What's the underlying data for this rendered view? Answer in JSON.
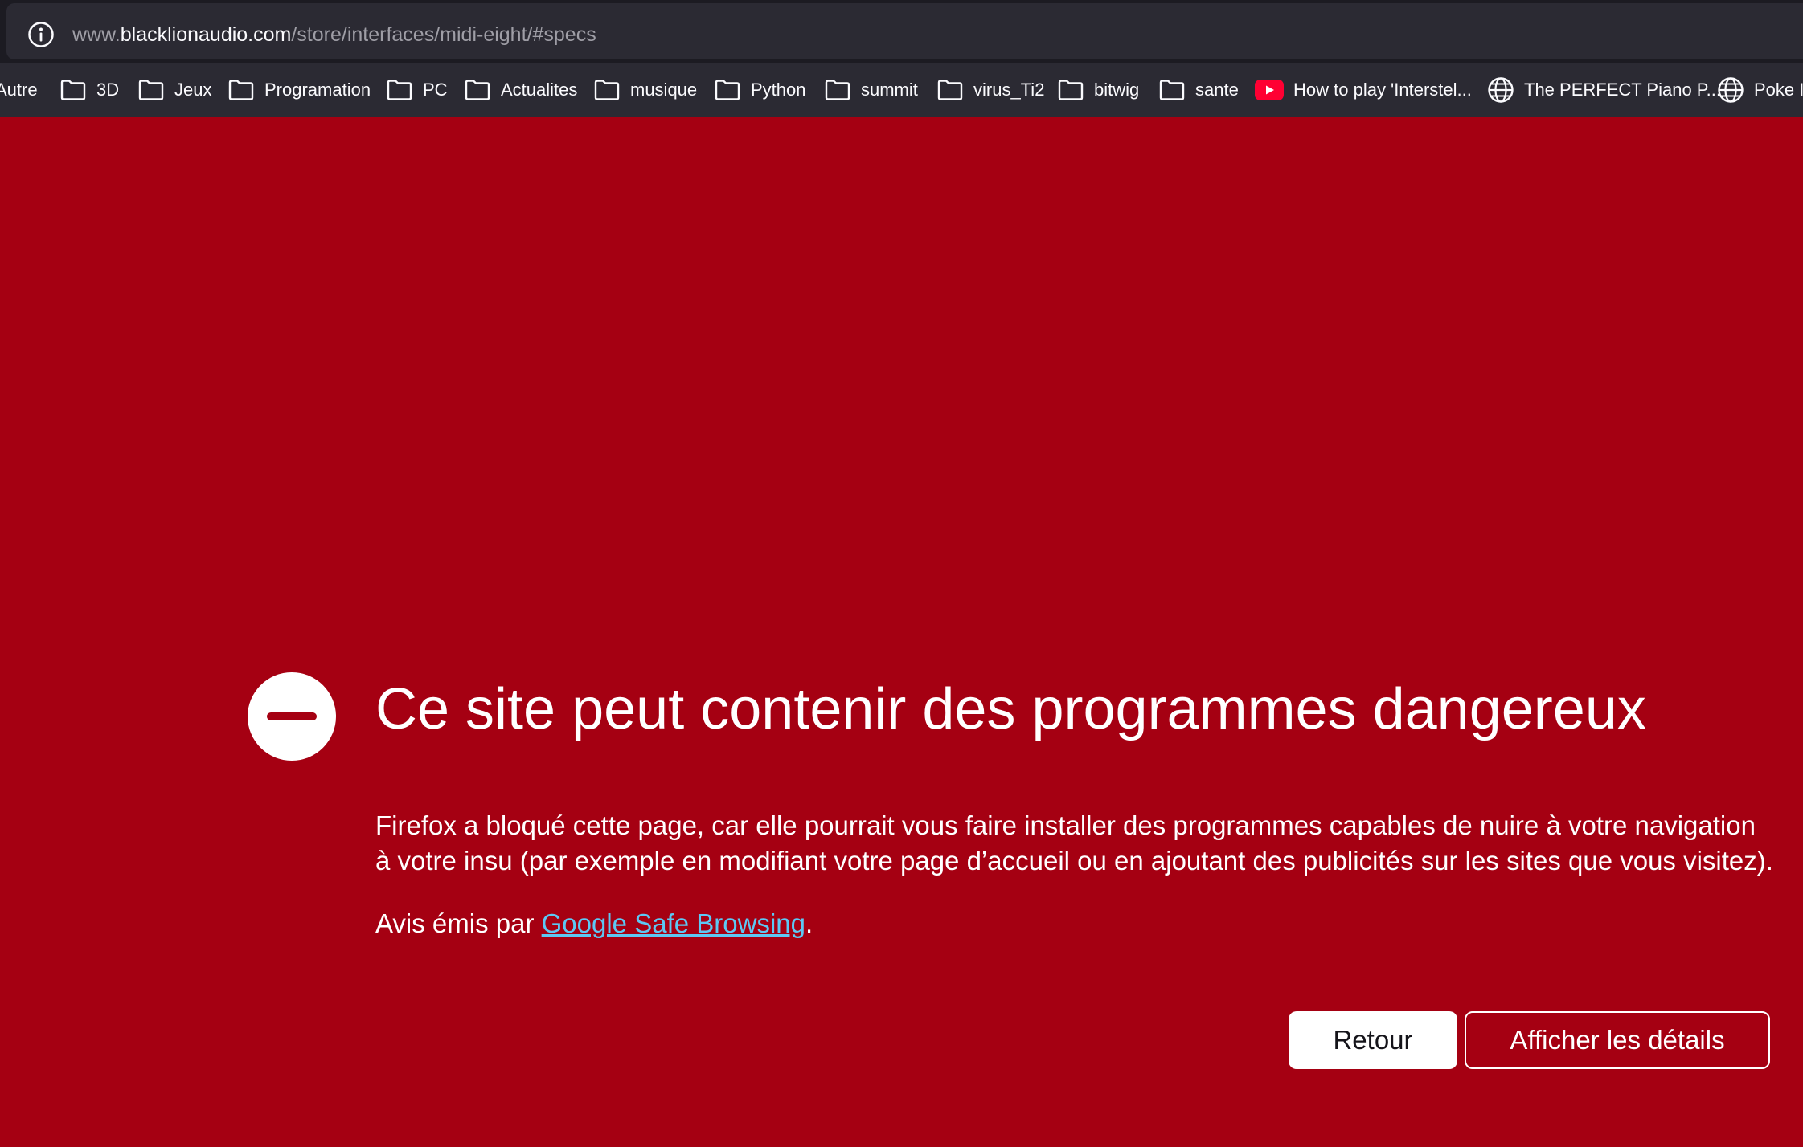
{
  "urlbar": {
    "url_prefix": "www.",
    "url_domain": "blacklionaudio.com",
    "url_path": "/store/interfaces/midi-eight/#specs",
    "icon": "info-icon"
  },
  "bookmarks": [
    {
      "label": "Autre",
      "icon": "folder-icon"
    },
    {
      "label": "3D",
      "icon": "folder-icon"
    },
    {
      "label": "Jeux",
      "icon": "folder-icon"
    },
    {
      "label": "Programation",
      "icon": "folder-icon"
    },
    {
      "label": "PC",
      "icon": "folder-icon"
    },
    {
      "label": "Actualites",
      "icon": "folder-icon"
    },
    {
      "label": "musique",
      "icon": "folder-icon"
    },
    {
      "label": "Python",
      "icon": "folder-icon"
    },
    {
      "label": "summit",
      "icon": "folder-icon"
    },
    {
      "label": "virus_Ti2",
      "icon": "folder-icon"
    },
    {
      "label": "bitwig",
      "icon": "folder-icon"
    },
    {
      "label": "sante",
      "icon": "folder-icon"
    },
    {
      "label": "How to play 'Interstel...",
      "icon": "youtube-icon"
    },
    {
      "label": "The PERFECT Piano P...",
      "icon": "globe-icon"
    },
    {
      "label": "Poke In",
      "icon": "globe-icon"
    }
  ],
  "error": {
    "icon": "blocked-icon",
    "title": "Ce site peut contenir des programmes dangereux",
    "description": "Firefox a bloqué cette page, car elle pourrait vous faire installer des programmes capables de nuire à votre navigation à votre insu (par exemple en modifiant votre page d’accueil ou en ajoutant des publicités sur les sites que vous visitez).",
    "source_prefix": "Avis émis par ",
    "source_link": "Google Safe Browsing",
    "source_suffix": ".",
    "back_button": "Retour",
    "details_button": "Afficher les détails"
  },
  "colors": {
    "page_background": "#a50012",
    "urlbar_background": "#2b2a33",
    "link": "#5dc8f4",
    "youtube": "#ff0033"
  }
}
